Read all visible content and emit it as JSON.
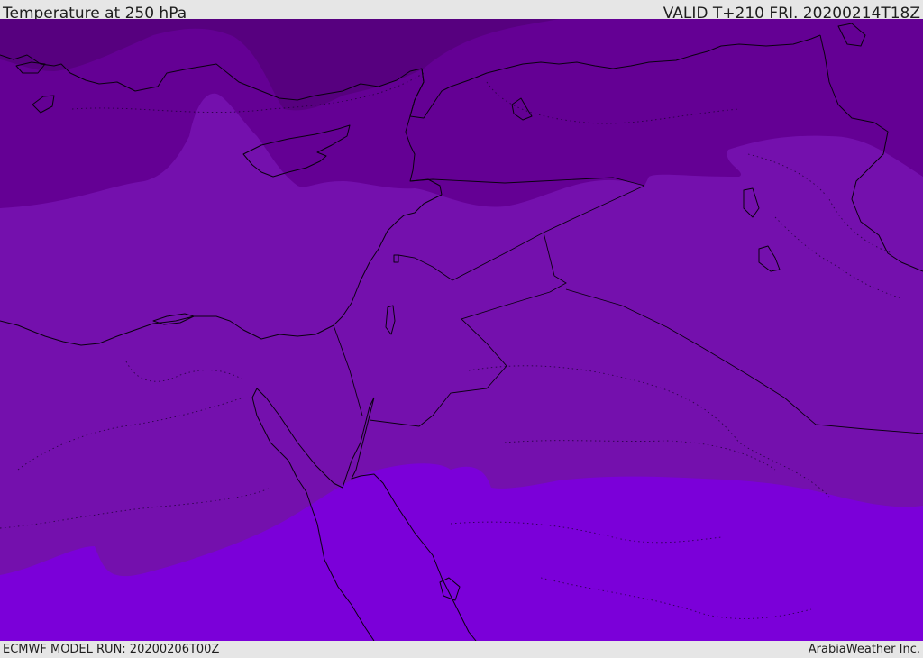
{
  "header": {
    "title": "Temperature at 250 hPa",
    "valid_time": "VALID T+210 FRI. 20200214T18Z"
  },
  "footer": {
    "model_run": "ECMWF MODEL RUN: 20200206T00Z",
    "credit": "ArabiaWeather Inc."
  },
  "colors": {
    "band_coldest": "#57007f",
    "band_cold": "#640094",
    "band_mid": "#7410ad",
    "band_warm": "#7b00d9",
    "bar_background": "#e6e6e6",
    "line": "#0a0010"
  }
}
